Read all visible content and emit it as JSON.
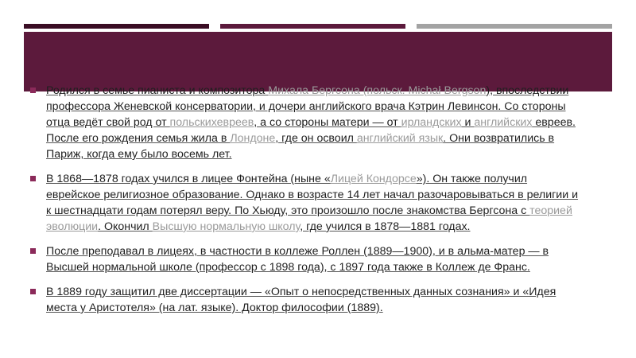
{
  "colors": {
    "banner": "#5c1a3c",
    "bar_dark": "#3a0d24",
    "bar_gray": "#a3a3a3",
    "bullet": "#8b2a5a",
    "link": "#9a9a9a"
  },
  "paragraphs": [
    [
      {
        "t": "Родился в семье пианиста и композитора "
      },
      {
        "t": "Михала Бергсона (польск. Michał Bergson",
        "link": true
      },
      {
        "t": "), впоследствии профессора Женевской консерватории, и дочери английского врача Кэтрин Левинсон. Со стороны отца ведёт свой род от "
      },
      {
        "t": "польскихевреев",
        "link": true
      },
      {
        "t": ", а со стороны матери — от "
      },
      {
        "t": "ирландских",
        "link": true
      },
      {
        "t": " и "
      },
      {
        "t": "английских",
        "link": true
      },
      {
        "t": " евреев. После его рождения семья жила в "
      },
      {
        "t": "Лондоне",
        "link": true
      },
      {
        "t": ", где он освоил "
      },
      {
        "t": "английский язык",
        "link": true
      },
      {
        "t": ". Они возвратились в Париж, когда ему было восемь лет."
      }
    ],
    [
      {
        "t": "В 1868—1878 годах учился в лицее Фонтейна (ныне «"
      },
      {
        "t": "Лицей Кондорсе",
        "link": true
      },
      {
        "t": "»). Он также получил еврейское религиозное образование. Однако в возрасте 14 лет начал разочаровываться в религии и к шестнадцати годам потерял веру. По Хьюду, это произошло после знакомства Бергсона с "
      },
      {
        "t": "теорией эволюции",
        "link": true
      },
      {
        "t": ". Окончил "
      },
      {
        "t": "Высшую нормальную школу",
        "link": true
      },
      {
        "t": ", где учился в 1878—1881 годах."
      }
    ],
    [
      {
        "t": "После преподавал в лицеях, в частности в коллеже Роллен (1889—1900), и в альма-матер — в Высшей нормальной школе (профессор с 1898 года), с 1897 года также в Коллеж де Франс."
      }
    ],
    [
      {
        "t": "В 1889 году защитил две диссертации — «Опыт о непосредственных данных сознания» и «Идея места у Аристотеля» (на лат. языке). Доктор философии (1889)."
      }
    ]
  ]
}
